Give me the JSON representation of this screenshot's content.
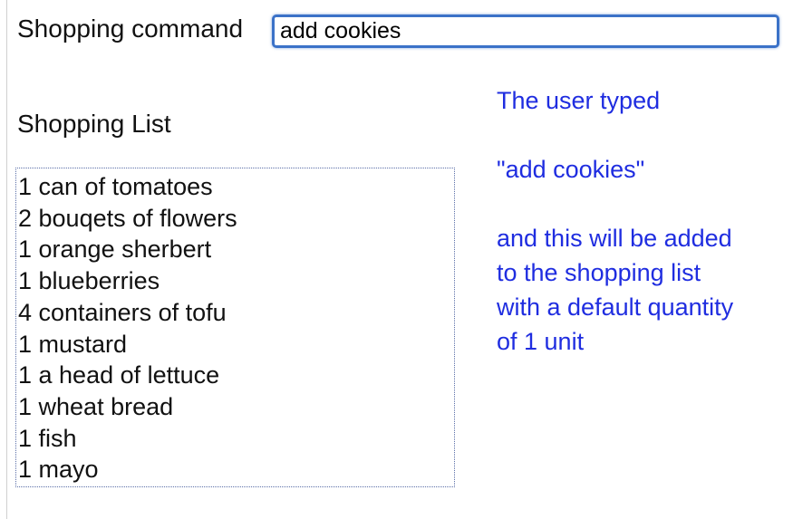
{
  "command": {
    "label": "Shopping command",
    "value": "add cookies"
  },
  "list": {
    "heading": "Shopping List",
    "items": [
      "1 can of tomatoes",
      "2 bouqets of flowers",
      "1 orange sherbert",
      "1 blueberries",
      "4 containers of tofu",
      "1 mustard",
      "1 a head of lettuce",
      "1 wheat bread",
      "1 fish",
      "1 mayo"
    ]
  },
  "annotation": {
    "line1": "The user typed",
    "line2": "\"add cookies\"",
    "line3": "and this will be added",
    "line4": "to the shopping list",
    "line5": "with a default quantity",
    "line6": "of 1 unit",
    "color": "#1f2de0"
  }
}
